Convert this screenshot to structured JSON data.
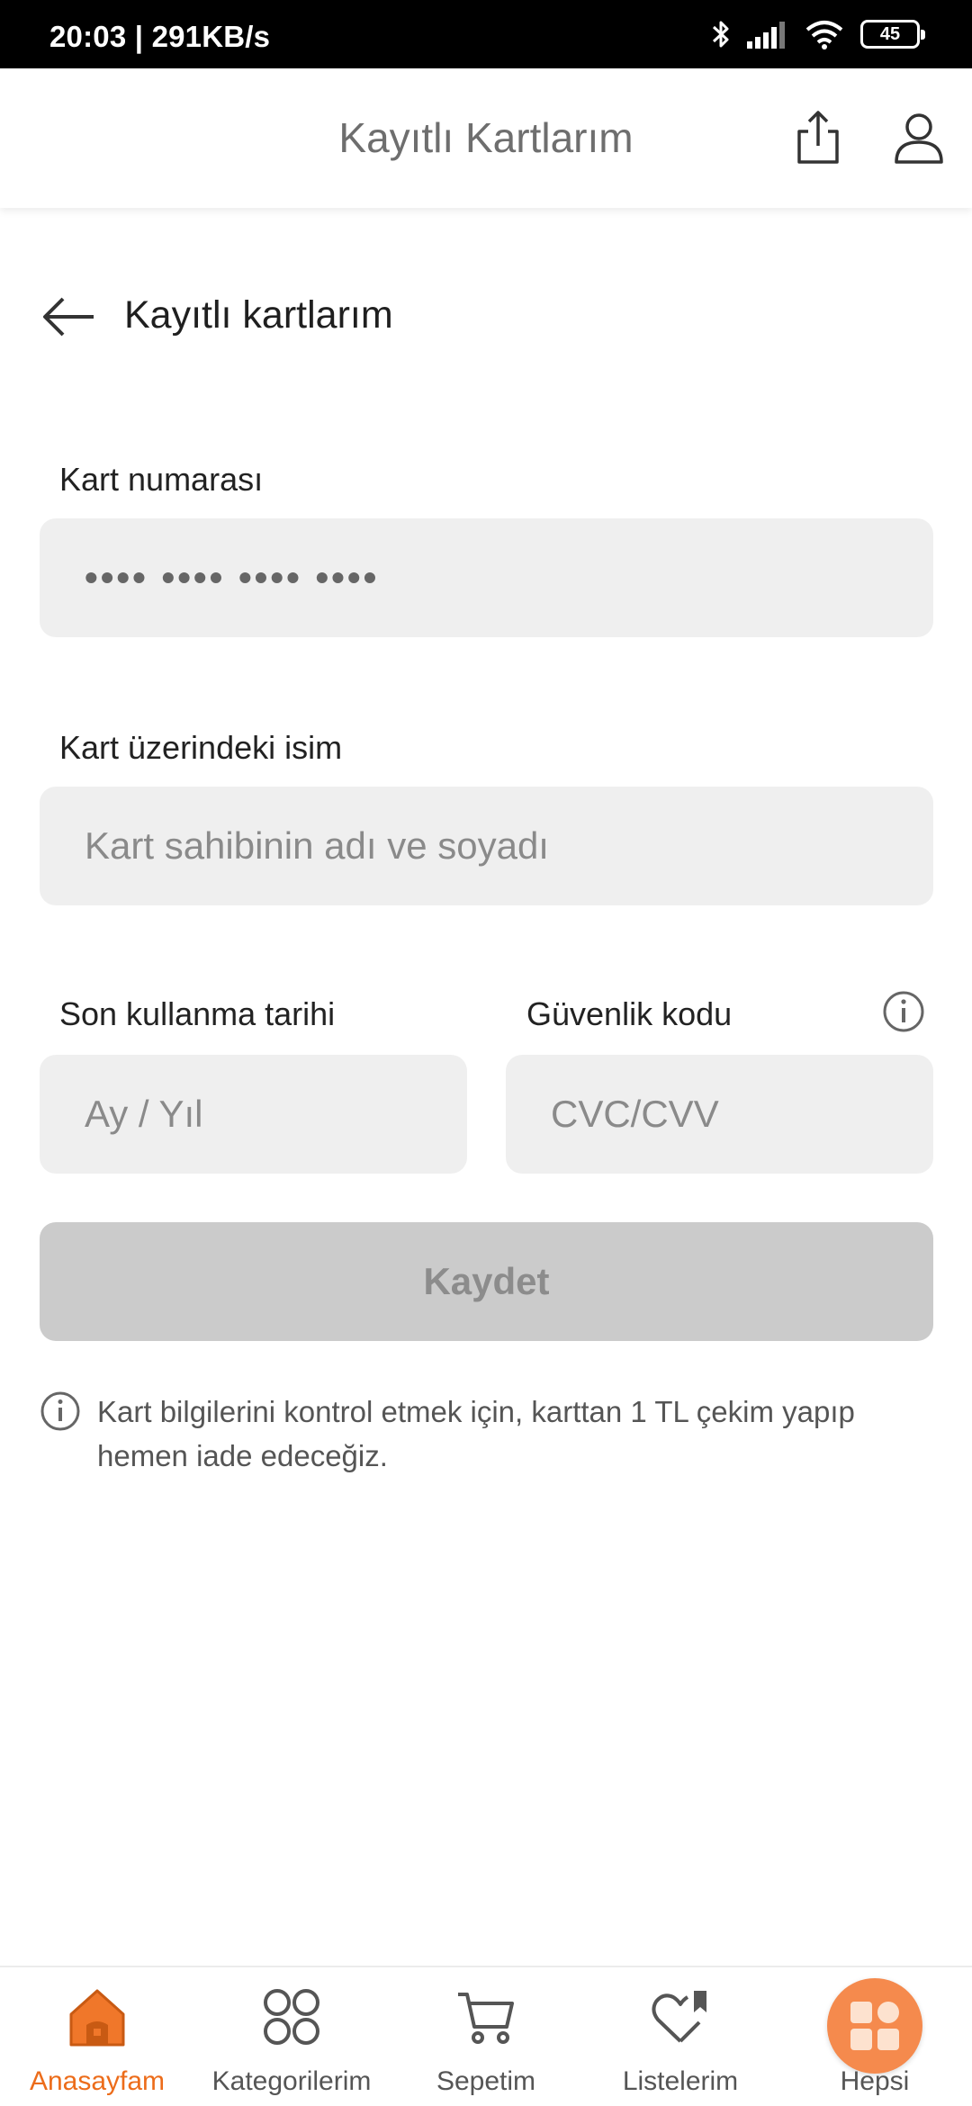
{
  "status_bar": {
    "time": "20:03 | 291KB/s",
    "battery": "45",
    "icons": [
      "bluetooth-icon",
      "signal-icon",
      "wifi-icon",
      "battery-icon"
    ]
  },
  "header": {
    "title": "Kayıtlı Kartlarım",
    "share_icon": "share-icon",
    "user_icon": "user-icon"
  },
  "page": {
    "back_icon": "back-arrow-icon",
    "title": "Kayıtlı kartlarım"
  },
  "form": {
    "card_number": {
      "label": "Kart numarası",
      "placeholder": "•••• •••• •••• ••••"
    },
    "card_name": {
      "label": "Kart üzerindeki isim",
      "placeholder": "Kart sahibinin adı ve soyadı"
    },
    "expiry": {
      "label": "Son kullanma tarihi",
      "placeholder": "Ay / Yıl"
    },
    "security": {
      "label": "Güvenlik kodu",
      "placeholder": "CVC/CVV"
    },
    "save_label": "Kaydet",
    "note": "Kart bilgilerini kontrol etmek için, karttan 1 TL çekim yapıp hemen iade edeceğiz."
  },
  "bottom_nav": {
    "items": [
      {
        "label": "Anasayfam",
        "icon": "home-icon",
        "active": true
      },
      {
        "label": "Kategorilerim",
        "icon": "categories-icon",
        "active": false
      },
      {
        "label": "Sepetim",
        "icon": "cart-icon",
        "active": false
      },
      {
        "label": "Listelerim",
        "icon": "heart-list-icon",
        "active": false
      },
      {
        "label": "Hepsi",
        "icon": "hepsi-grid-icon",
        "active": false
      }
    ]
  },
  "colors": {
    "accent": "#ec6c1a",
    "hepsi_circle": "#f58a4d",
    "input_bg": "#efefef",
    "disabled_button": "#cbcbcb"
  }
}
